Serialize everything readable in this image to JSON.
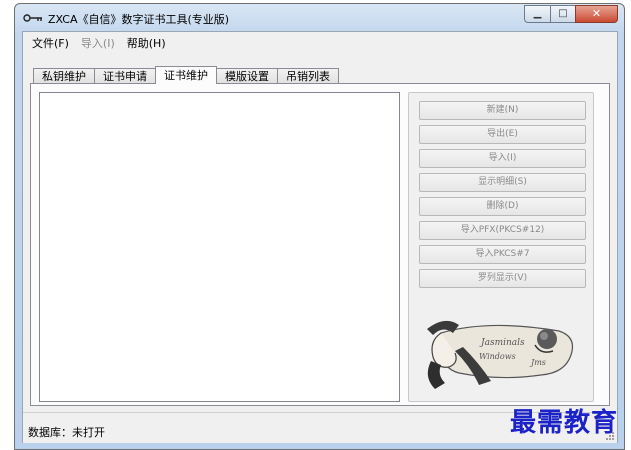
{
  "window": {
    "title": "ZXCA《自信》数字证书工具(专业版)",
    "caption_buttons": {
      "minimize": "minimize-icon",
      "maximize": "maximize-icon",
      "close": "close-icon"
    }
  },
  "menu": {
    "items": [
      {
        "label": "文件(F)",
        "enabled": true
      },
      {
        "label": "导入(I)",
        "enabled": false
      },
      {
        "label": "帮助(H)",
        "enabled": true
      }
    ]
  },
  "tabs": {
    "items": [
      {
        "label": "私钥维护",
        "active": false
      },
      {
        "label": "证书申请",
        "active": false
      },
      {
        "label": "证书维护",
        "active": true
      },
      {
        "label": "模版设置",
        "active": false
      },
      {
        "label": "吊销列表",
        "active": false
      }
    ]
  },
  "actions": {
    "items": [
      {
        "label": "新建(N)",
        "enabled": false
      },
      {
        "label": "导出(E)",
        "enabled": false
      },
      {
        "label": "导入(I)",
        "enabled": false
      },
      {
        "label": "显示明细(S)",
        "enabled": false
      },
      {
        "label": "删除(D)",
        "enabled": false
      },
      {
        "label": "导入PFX(PKCS#12)",
        "enabled": false
      },
      {
        "label": "导入PKCS#7",
        "enabled": false
      },
      {
        "label": "罗列显示(V)",
        "enabled": false
      }
    ]
  },
  "logo": {
    "text_line1": "Jasminals",
    "text_line2": "Windows",
    "text_line3": "Jms"
  },
  "status": {
    "text": "数据库：未打开"
  },
  "watermark": {
    "text": "最需教育"
  },
  "colors": {
    "accent_title": "#c2d7ee",
    "close_button": "#c94a32",
    "watermark": "#1a22c8",
    "disabled_text": "#8a8a8a"
  }
}
